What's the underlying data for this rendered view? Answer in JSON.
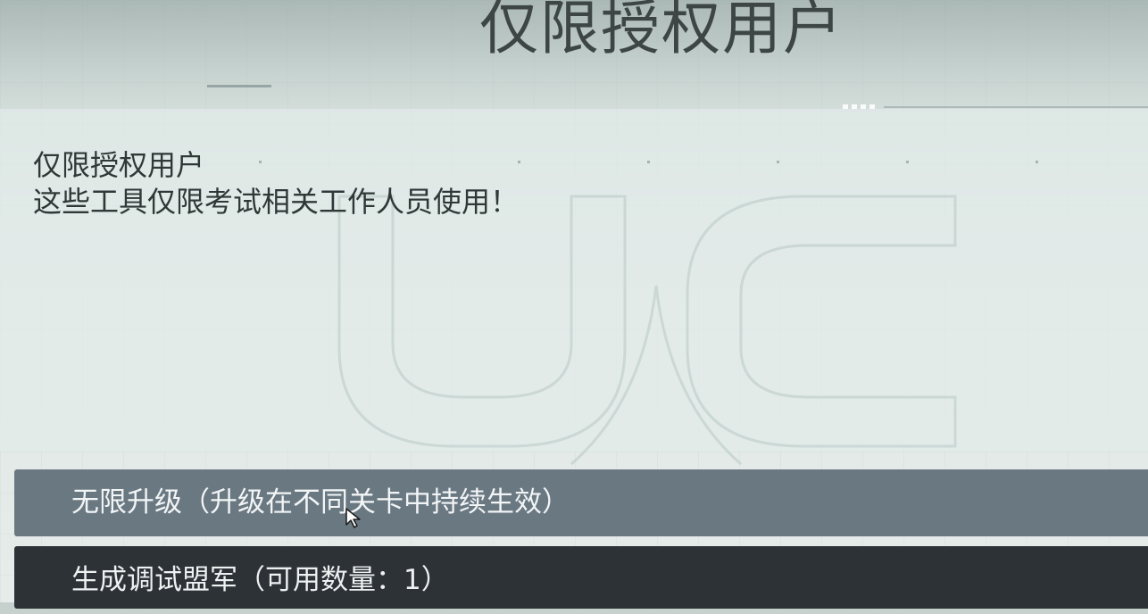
{
  "header": {
    "title": "仅限授权用户"
  },
  "info": {
    "title": "仅限授权用户",
    "description": "这些工具仅限考试相关工作人员使用！"
  },
  "menu": {
    "items": [
      {
        "label": "无限升级（升级在不同关卡中持续生效）",
        "selected": true
      },
      {
        "label": "生成调试盟军（可用数量：1）",
        "selected": false
      }
    ]
  },
  "colors": {
    "selected_item": "#6a7882",
    "normal_item": "#2c3236",
    "text_dark": "#2f3837"
  }
}
